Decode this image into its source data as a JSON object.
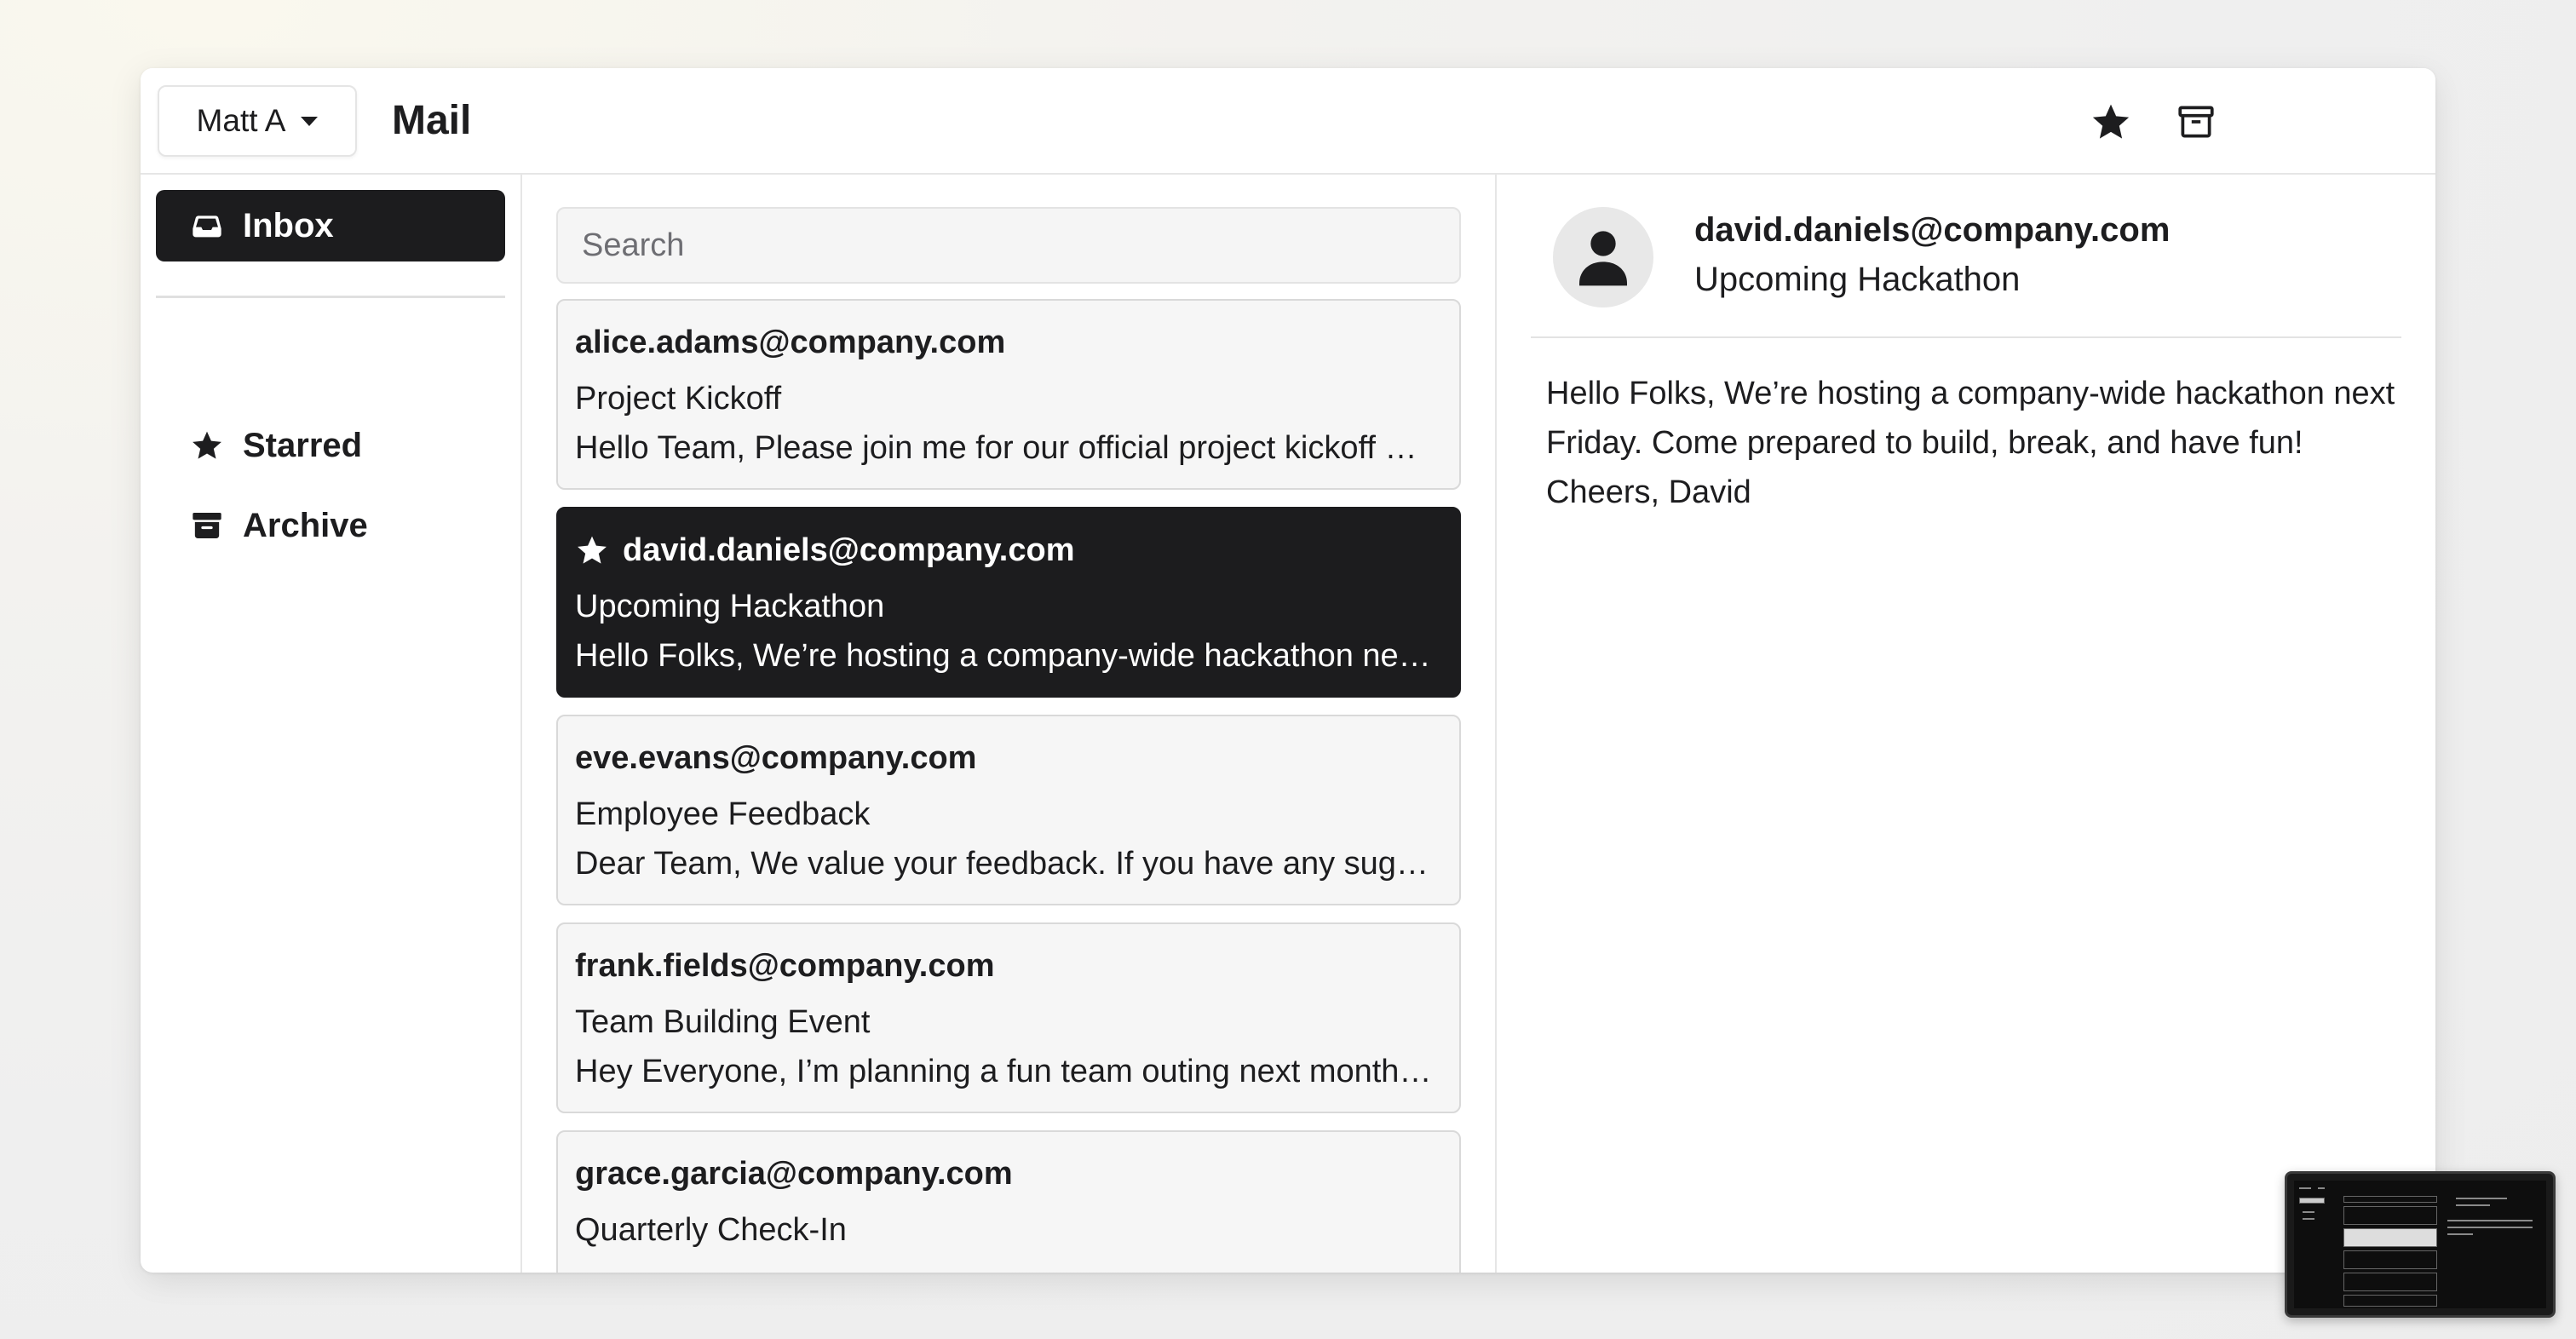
{
  "topbar": {
    "account_label": "Matt A",
    "app_title": "Mail"
  },
  "sidebar": {
    "inbox_label": "Inbox",
    "items": [
      {
        "label": "Starred",
        "icon": "star-icon"
      },
      {
        "label": "Archive",
        "icon": "archive-icon"
      }
    ]
  },
  "search": {
    "placeholder": "Search"
  },
  "emails": [
    {
      "from": "alice.adams@company.com",
      "subject": "Project Kickoff",
      "preview": "Hello Team, Please join me for our official project kickoff …",
      "starred": false,
      "selected": false
    },
    {
      "from": "david.daniels@company.com",
      "subject": "Upcoming Hackathon",
      "preview": "Hello Folks, We’re hosting a company-wide hackathon ne…",
      "starred": true,
      "selected": true
    },
    {
      "from": "eve.evans@company.com",
      "subject": "Employee Feedback",
      "preview": "Dear Team, We value your feedback. If you have any sug…",
      "starred": false,
      "selected": false
    },
    {
      "from": "frank.fields@company.com",
      "subject": "Team Building Event",
      "preview": "Hey Everyone, I’m planning a fun team outing next month…",
      "starred": false,
      "selected": false
    },
    {
      "from": "grace.garcia@company.com",
      "subject": "Quarterly Check-In",
      "preview": "",
      "starred": false,
      "selected": false
    }
  ],
  "reader": {
    "from": "david.daniels@company.com",
    "subject": "Upcoming Hackathon",
    "body": "Hello Folks, We’re hosting a company-wide hackathon next Friday. Come prepared to build, break, and have fun! Cheers, David"
  },
  "colors": {
    "selected_bg": "#1c1c1e",
    "card_bg": "#f6f6f6",
    "text": "#1d1d1f"
  }
}
